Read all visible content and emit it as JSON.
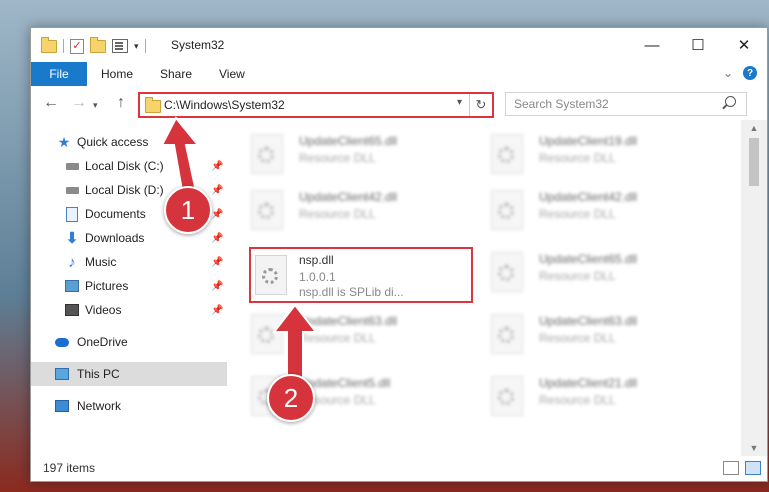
{
  "window": {
    "title": "System32",
    "controls": {
      "minimize": "—",
      "maximize": "☐",
      "close": "✕"
    }
  },
  "ribbon": {
    "tabs": [
      "File",
      "Home",
      "Share",
      "View"
    ],
    "help": "?"
  },
  "navigation": {
    "back": "←",
    "forward": "→",
    "up": "↑",
    "address": "C:\\Windows\\System32",
    "search_placeholder": "Search System32"
  },
  "sidebar": {
    "items": [
      {
        "label": "Quick access",
        "icon": "star-icon"
      },
      {
        "label": "Local Disk (C:)",
        "icon": "drive-icon",
        "pinned": true
      },
      {
        "label": "Local Disk (D:)",
        "icon": "drive-icon",
        "pinned": true
      },
      {
        "label": "Documents",
        "icon": "documents-icon",
        "pinned": true
      },
      {
        "label": "Downloads",
        "icon": "downloads-icon",
        "pinned": true
      },
      {
        "label": "Music",
        "icon": "music-icon",
        "pinned": true
      },
      {
        "label": "Pictures",
        "icon": "pictures-icon",
        "pinned": true
      },
      {
        "label": "Videos",
        "icon": "videos-icon",
        "pinned": true
      },
      {
        "label": "OneDrive",
        "icon": "onedrive-icon"
      },
      {
        "label": "This PC",
        "icon": "this-pc-icon",
        "selected": true
      },
      {
        "label": "Network",
        "icon": "network-icon"
      }
    ]
  },
  "files": {
    "left": [
      {
        "name": "UpdateClient65.dll",
        "type": "Resource DLL"
      },
      {
        "name": "UpdateClient42.dll",
        "type": "Resource DLL"
      },
      {
        "name": "nsp.dll",
        "version": "1.0.0.1",
        "description": "nsp.dll is SPLib di..."
      },
      {
        "name": "UpdateClient63.dll",
        "type": "Resource DLL"
      },
      {
        "name": "UpdateClient5.dll",
        "type": "Resource DLL"
      }
    ],
    "right": [
      {
        "name": "UpdateClient19.dll",
        "type": "Resource DLL"
      },
      {
        "name": "UpdateClient42.dll",
        "type": "Resource DLL"
      },
      {
        "name": "UpdateClient65.dll",
        "type": "Resource DLL"
      },
      {
        "name": "UpdateClient63.dll",
        "type": "Resource DLL"
      },
      {
        "name": "UpdateClient21.dll",
        "type": "Resource DLL"
      }
    ]
  },
  "status": {
    "item_count": "197 items"
  },
  "annotations": {
    "step1": "1",
    "step2": "2"
  },
  "colors": {
    "accent": "#1979ca",
    "highlight": "#d9363e",
    "selected_bg": "#dcdcdc"
  }
}
